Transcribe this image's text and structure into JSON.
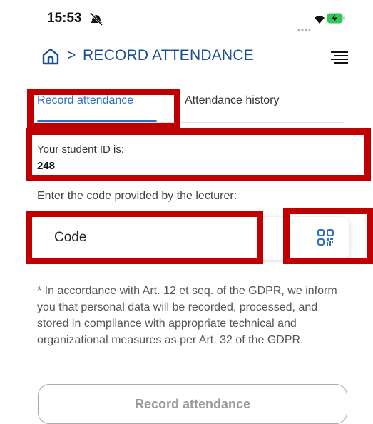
{
  "status_bar": {
    "time": "15:53"
  },
  "header": {
    "title": "RECORD ATTENDANCE",
    "separator": ">"
  },
  "tabs": [
    {
      "label": "Record attendance",
      "active": true
    },
    {
      "label": "Attendance history",
      "active": false
    }
  ],
  "student": {
    "id_label": "Your student ID is:",
    "id_value": "248"
  },
  "code": {
    "prompt": "Enter the code provided by the lecturer:",
    "placeholder": "Code",
    "value": ""
  },
  "gdpr_notice": "* In accordance with Art. 12 et seq. of the GDPR, we inform you that personal data will be recorded, processed, and stored in compliance with appropriate technical and organizational measures as per Art. 32 of the GDPR.",
  "actions": {
    "submit_label": "Record attendance"
  },
  "colors": {
    "accent": "#2f6fbf",
    "title": "#1a4f96",
    "highlight": "#c00000"
  }
}
